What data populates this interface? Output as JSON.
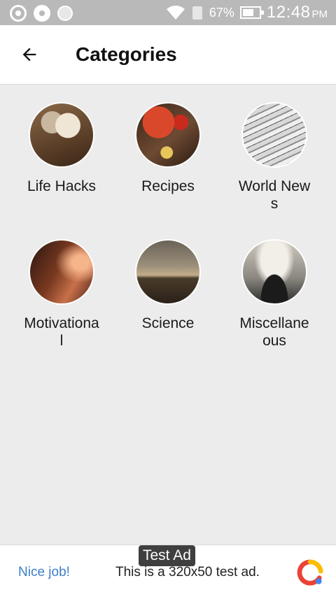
{
  "status_bar": {
    "battery_percent": "67%",
    "battery_level": 0.67,
    "time": "12:48",
    "ampm": "PM",
    "icons": [
      "notification-icon",
      "disc-icon",
      "circle-icon",
      "wifi-icon",
      "signal-icon",
      "battery-charging-icon"
    ]
  },
  "header": {
    "title": "Categories",
    "back_icon": "arrow-left-icon"
  },
  "categories": [
    {
      "label": "Life Hacks",
      "image": "life-hacks-thumbnail"
    },
    {
      "label": "Recipes",
      "image": "recipes-thumbnail"
    },
    {
      "label": "World News",
      "image": "world-news-thumbnail"
    },
    {
      "label": "Motivational",
      "image": "motivational-thumbnail"
    },
    {
      "label": "Science",
      "image": "science-thumbnail"
    },
    {
      "label": "Miscellaneous",
      "image": "miscellaneous-thumbnail"
    }
  ],
  "ad": {
    "tag": "Test Ad",
    "nice_job": "Nice job!",
    "text": "This is a 320x50 test ad."
  },
  "colors": {
    "status_bar_bg": "#b9b9b9",
    "content_bg": "#ececec",
    "ad_link": "#3c7fc9"
  }
}
